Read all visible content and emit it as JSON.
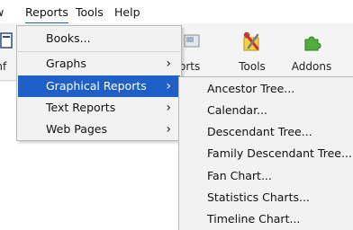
{
  "menubar": {
    "view": "w",
    "reports": "Reports",
    "tools": "Tools",
    "help": "Help"
  },
  "toolbar": {
    "left_label": "onf",
    "reports_label": "eports",
    "tools_label": "Tools",
    "addons_label": "Addons",
    "icons": [
      "document-icon",
      "reports-icon",
      "tools-icon",
      "puzzle-addon-icon"
    ]
  },
  "reports_menu": {
    "items": [
      {
        "label": "Books...",
        "submenu": false
      },
      {
        "label": "Graphs",
        "submenu": true
      },
      {
        "label": "Graphical Reports",
        "submenu": true,
        "highlighted": true
      },
      {
        "label": "Text Reports",
        "submenu": true
      },
      {
        "label": "Web Pages",
        "submenu": true
      }
    ],
    "arrow": "›"
  },
  "graphical_reports_submenu": {
    "items": [
      "Ancestor Tree...",
      "Calendar...",
      "Descendant Tree...",
      "Family Descendant Tree...",
      "Fan Chart...",
      "Statistics Charts...",
      "Timeline Chart..."
    ]
  },
  "colors": {
    "highlight": "#1e5fc8",
    "menu_bg": "#f2f2f2",
    "accent_underline": "#1a64c8"
  }
}
